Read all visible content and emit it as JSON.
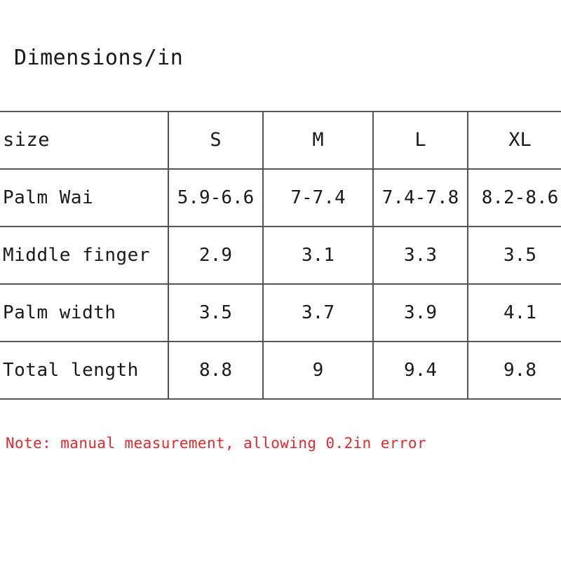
{
  "title": "Dimensions/in",
  "note": {
    "text": "Note: manual measurement, allowing 0.2in error",
    "color": "#e8262c"
  },
  "style": {
    "border_color": "#555555",
    "text_color": "#1a1a1a",
    "background_color": "#ffffff"
  },
  "chart_data": {
    "type": "table",
    "title": "Dimensions/in",
    "columns": [
      "size",
      "S",
      "M",
      "L",
      "XL"
    ],
    "rows": [
      {
        "label": "Palm Wai",
        "values": [
          "5.9-6.6",
          "7-7.4",
          "7.4-7.8",
          "8.2-8.6"
        ]
      },
      {
        "label": "Middle finger",
        "values": [
          "2.9",
          "3.1",
          "3.3",
          "3.5"
        ]
      },
      {
        "label": "Palm width",
        "values": [
          "3.5",
          "3.7",
          "3.9",
          "4.1"
        ]
      },
      {
        "label": "Total length",
        "values": [
          "8.8",
          "9",
          "9.4",
          "9.8"
        ]
      }
    ],
    "unit": "in",
    "annotations": [
      "Note: manual measurement, allowing 0.2in error"
    ]
  }
}
